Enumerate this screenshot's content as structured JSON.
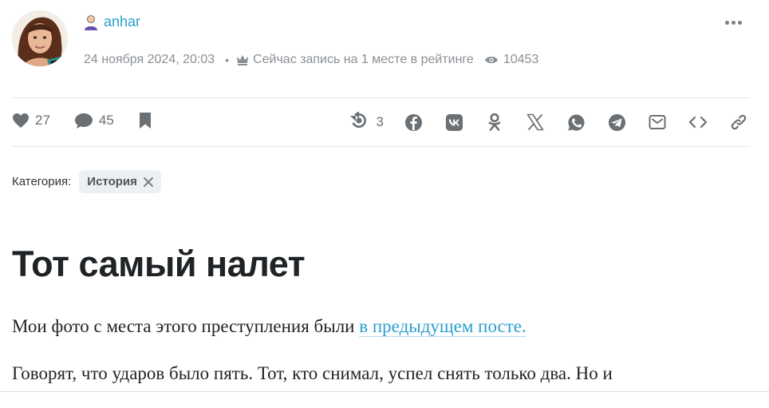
{
  "author": {
    "name": "anhar",
    "avatar": "author-photo",
    "badge_icon": "user-silhouette-icon"
  },
  "meta": {
    "date": "24 ноября 2024, 20:03",
    "rating_text": "Сейчас запись на 1 месте в рейтинге",
    "views": "10453",
    "rating_icon": "crown-icon",
    "views_icon": "eye-icon"
  },
  "menu": {
    "icon": "more-dots-icon"
  },
  "actions": {
    "likes": "27",
    "comments": "45",
    "like_icon": "heart-icon",
    "comment_icon": "comment-icon",
    "bookmark_icon": "bookmark-icon"
  },
  "share": {
    "reposts": "3",
    "services": [
      "repost",
      "facebook",
      "vk",
      "odnoklassniki",
      "x",
      "whatsapp",
      "telegram",
      "email",
      "embed",
      "link"
    ]
  },
  "category": {
    "label": "Категория:",
    "tag": "История"
  },
  "post": {
    "title": "Тот самый налет",
    "para1_text": "Мои фото с  места этого преступления были ",
    "para1_link": "в предыдущем посте.",
    "para2_text": "Говорят, что ударов было пять. Тот, кто снимал, успел снять только два. Но и"
  },
  "colors": {
    "accent": "#2a9fd0",
    "muted": "#8a8f94",
    "icon": "#6b7075",
    "title": "#1f2325",
    "tag_bg": "#edf0f3"
  }
}
